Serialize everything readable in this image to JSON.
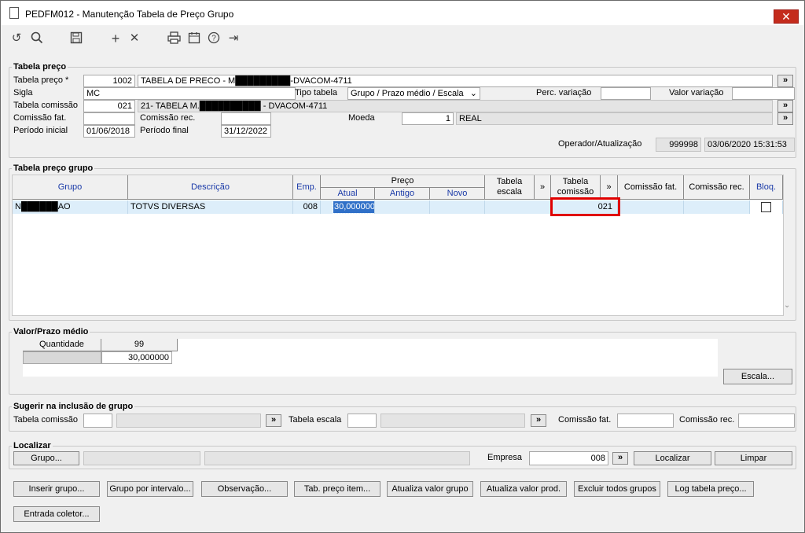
{
  "window": {
    "title": "PEDFM012 - Manutenção Tabela de Preço Grupo",
    "close_glyph": "✕"
  },
  "toolbar": {
    "undo_icon": "↺",
    "search_icon": "🔍",
    "save_icon": "💾",
    "add_icon": "+",
    "delete_icon": "✕",
    "print_icon": "🖶",
    "calendar_icon": "📅",
    "help_icon": "?",
    "exit_icon": "⇥"
  },
  "tabela_preco": {
    "section_label": "Tabela preço",
    "tabela_preco_label": "Tabela preço *",
    "tabela_preco_code": "1002",
    "tabela_preco_desc": "TABELA DE PRECO - M█████████-DVACOM-4711",
    "sigla_label": "Sigla",
    "sigla_value": "MC",
    "tipo_tabela_label": "Tipo tabela",
    "tipo_tabela_value": "Grupo / Prazo médio / Escala",
    "perc_variacao_label": "Perc. variação",
    "perc_variacao_value": "",
    "valor_variacao_label": "Valor variação",
    "valor_variacao_value": "",
    "tabela_comissao_label": "Tabela comissão",
    "tabela_comissao_code": "021",
    "tabela_comissao_desc": "21- TABELA M.██████████ - DVACOM-4711",
    "comissao_fat_label": "Comissão fat.",
    "comissao_fat_value": "",
    "comissao_rec_label": "Comissão rec.",
    "comissao_rec_value": "",
    "moeda_label": "Moeda",
    "moeda_code": "1",
    "moeda_desc": "REAL",
    "periodo_inicial_label": "Período inicial",
    "periodo_inicial_value": "01/06/2018",
    "periodo_final_label": "Período final",
    "periodo_final_value": "31/12/2022",
    "operador_label": "Operador/Atualização",
    "operador_value": "999998",
    "atualizacao_value": "03/06/2020 15:31:53",
    "lookup": "»"
  },
  "grupo_grid": {
    "section_label": "Tabela preço grupo",
    "headers": {
      "grupo": "Grupo",
      "descricao": "Descrição",
      "emp": "Emp.",
      "preco": "Preço",
      "atual": "Atual",
      "antigo": "Antigo",
      "novo": "Novo",
      "tabela_escala": "Tabela escala",
      "tabela_comissao": "Tabela comissão",
      "comissao_fat": "Comissão fat.",
      "comissao_rec": "Comissão rec.",
      "bloq": "Bloq.",
      "expand": "»"
    },
    "rows": [
      {
        "grupo": "N██████AO",
        "descricao": "TOTVS DIVERSAS",
        "emp": "008",
        "atual": "30,000000",
        "antigo": "",
        "novo": "",
        "tabela_escala": "",
        "tabela_comissao": "021",
        "comissao_fat": "",
        "comissao_rec": "",
        "bloq": false
      }
    ],
    "highlight_color": "#e00000"
  },
  "valor_prazo": {
    "section_label": "Valor/Prazo médio",
    "quantidade_label": "Quantidade",
    "quantidade_col": "99",
    "row_value": "30,000000",
    "escala_button": "Escala..."
  },
  "sugerir": {
    "section_label": "Sugerir na inclusão de grupo",
    "tabela_comissao_label": "Tabela comissão",
    "tabela_escala_label": "Tabela escala",
    "comissao_fat_label": "Comissão fat.",
    "comissao_rec_label": "Comissão rec.",
    "lookup": "»"
  },
  "localizar": {
    "section_label": "Localizar",
    "grupo_button": "Grupo...",
    "empresa_label": "Empresa",
    "empresa_value": "008",
    "lookup": "»",
    "localizar_button": "Localizar",
    "limpar_button": "Limpar"
  },
  "actions": {
    "inserir_grupo": "Inserir grupo...",
    "grupo_intervalo": "Grupo por intervalo...",
    "observacao": "Observação...",
    "tab_preco_item": "Tab. preço item...",
    "atualiza_valor_grupo": "Atualiza valor grupo",
    "atualiza_valor_prod": "Atualiza valor prod.",
    "excluir_todos": "Excluir todos grupos",
    "log_tabela": "Log tabela preço...",
    "entrada_coletor": "Entrada coletor..."
  }
}
